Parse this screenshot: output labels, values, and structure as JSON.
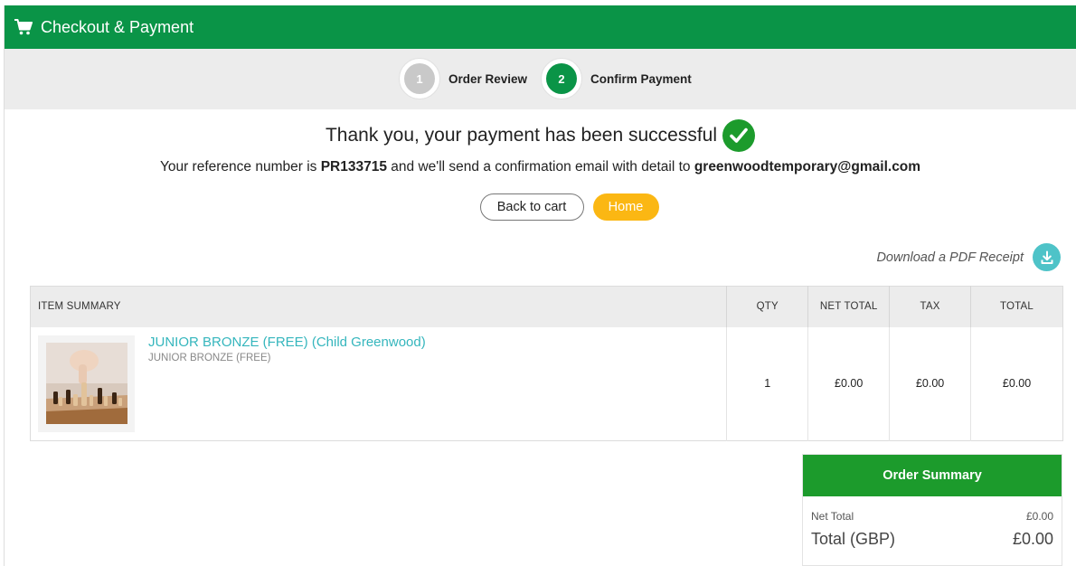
{
  "header": {
    "title": "Checkout & Payment",
    "icon": "shopping-cart-icon"
  },
  "stepper": {
    "steps": [
      {
        "number": "1",
        "label": "Order Review",
        "state": "inactive"
      },
      {
        "number": "2",
        "label": "Confirm Payment",
        "state": "active"
      }
    ]
  },
  "confirmation": {
    "title": "Thank you, your payment has been successful",
    "ref_prefix": "Your reference number is ",
    "reference": "PR133715",
    "ref_mid": " and we'll send a confirmation email with detail to ",
    "email": "greenwoodtemporary@gmail.com"
  },
  "actions": {
    "back_label": "Back to cart",
    "home_label": "Home"
  },
  "pdf": {
    "label": "Download a PDF Receipt"
  },
  "table": {
    "headers": {
      "item": "ITEM SUMMARY",
      "qty": "QTY",
      "net": "NET TOTAL",
      "tax": "TAX",
      "total": "TOTAL"
    },
    "rows": [
      {
        "name": "JUNIOR BRONZE (FREE) (Child Greenwood)",
        "subtitle": "JUNIOR BRONZE (FREE)",
        "qty": "1",
        "net": "£0.00",
        "tax": "£0.00",
        "total": "£0.00"
      }
    ]
  },
  "summary": {
    "title": "Order Summary",
    "net_label": "Net Total",
    "net_value": "£0.00",
    "total_label": "Total (GBP)",
    "total_value": "£0.00"
  },
  "colors": {
    "brand_green": "#0a9447",
    "success_green": "#1c9b2c",
    "accent_yellow": "#fbb713",
    "link_teal": "#35b6bd",
    "step_inactive": "#c9c9c9"
  }
}
